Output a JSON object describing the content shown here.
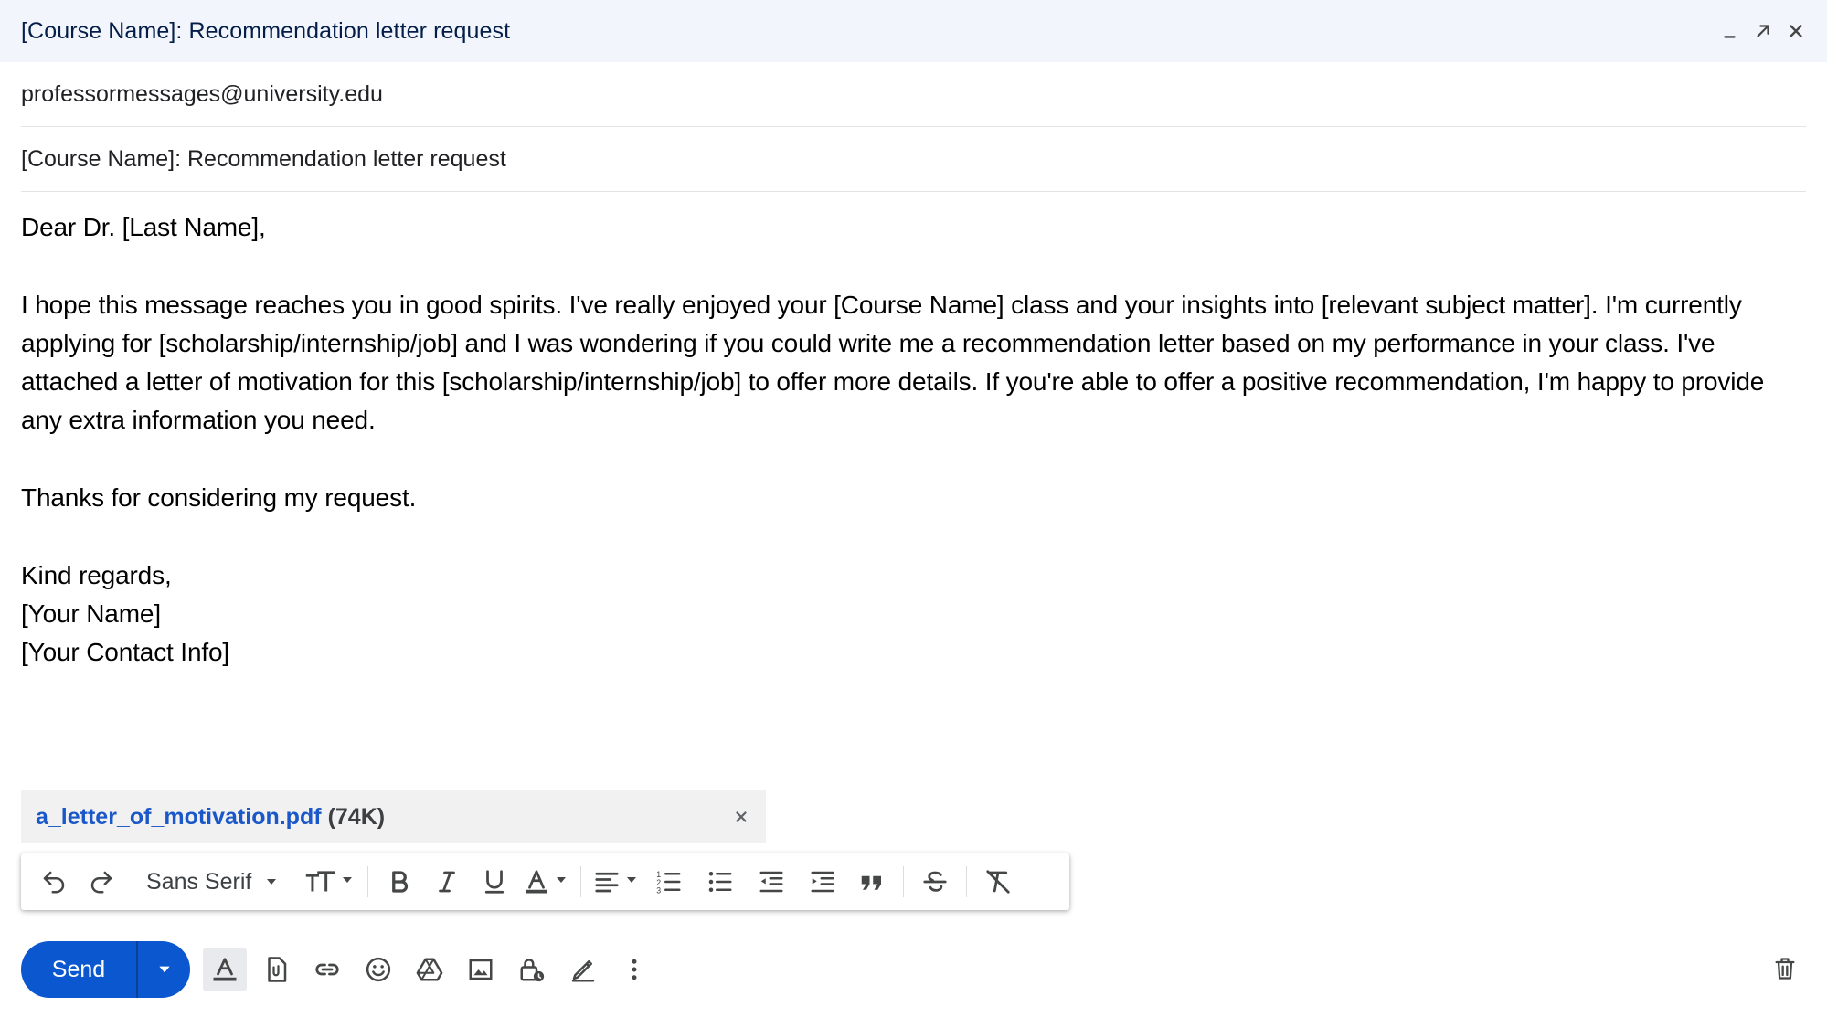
{
  "window": {
    "title": "[Course Name]: Recommendation letter request",
    "controls": [
      "minimize-icon",
      "expand-icon",
      "close-icon"
    ]
  },
  "to": {
    "value": "professormessages@university.edu"
  },
  "subject": {
    "value": "[Course Name]: Recommendation letter request"
  },
  "body": {
    "greeting": "Dear Dr. [Last Name],",
    "paragraph": "I hope this message reaches you in good spirits. I've really enjoyed your [Course Name] class and your insights into [relevant subject matter]. I'm currently applying for [scholarship/internship/job] and I was wondering if you could write me a recommendation letter based on my performance in your class. I've attached a letter of motivation for this [scholarship/internship/job] to offer more details. If you're able to offer a positive recommendation, I'm happy to provide any extra information you need.",
    "thanks": "Thanks for considering my request.",
    "closing": "Kind regards,",
    "name": "[Your Name]",
    "contact": "[Your Contact Info]"
  },
  "attachment": {
    "filename": "a_letter_of_motivation.pdf",
    "size": "(74K)"
  },
  "formatting_toolbar": {
    "font": "Sans Serif",
    "icons": [
      "undo-icon",
      "redo-icon",
      "font-size-icon",
      "bold-icon",
      "italic-icon",
      "underline-icon",
      "text-color-icon",
      "align-icon",
      "numbered-list-icon",
      "bulleted-list-icon",
      "indent-less-icon",
      "indent-more-icon",
      "quote-icon",
      "strikethrough-icon",
      "remove-formatting-icon"
    ]
  },
  "bottom_toolbar": {
    "send_label": "Send",
    "icons": [
      "formatting-options-icon",
      "attach-file-icon",
      "insert-link-icon",
      "emoji-icon",
      "drive-icon",
      "insert-photo-icon",
      "confidential-mode-icon",
      "signature-icon",
      "more-options-icon",
      "discard-draft-icon"
    ]
  },
  "colors": {
    "accent": "#0b57d0",
    "titlebar_bg": "#f2f6fc",
    "title_text": "#041e49",
    "link": "#1a57c8"
  }
}
